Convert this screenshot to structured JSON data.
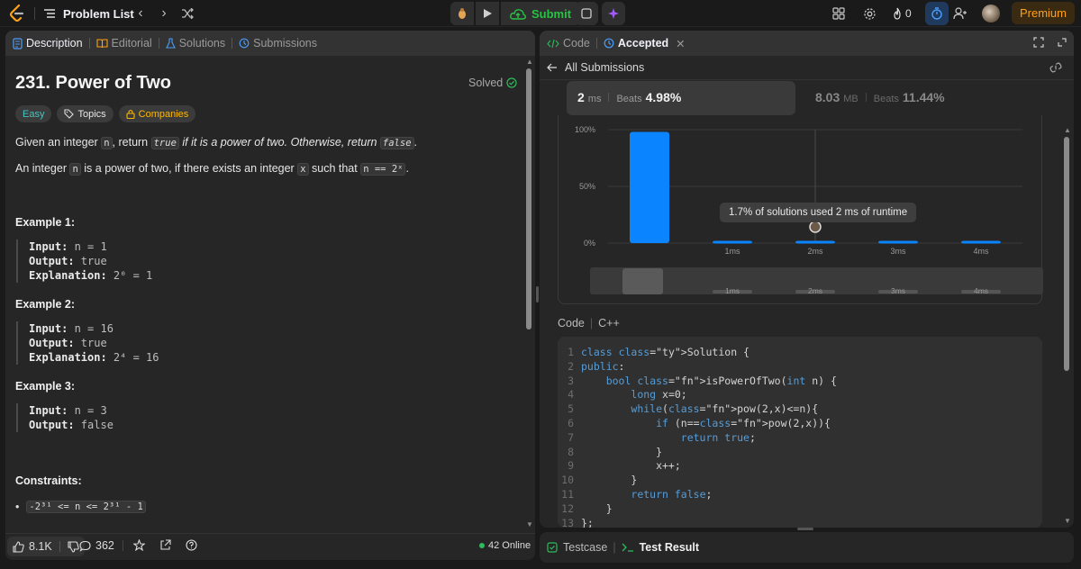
{
  "topbar": {
    "problem_list_label": "Problem List",
    "submit_label": "Submit",
    "fire_count": "0",
    "premium_label": "Premium"
  },
  "left_tabs": [
    {
      "label": "Description",
      "active": true,
      "icon": "description-icon"
    },
    {
      "label": "Editorial",
      "active": false,
      "icon": "book-icon"
    },
    {
      "label": "Solutions",
      "active": false,
      "icon": "flask-icon"
    },
    {
      "label": "Submissions",
      "active": false,
      "icon": "history-icon"
    }
  ],
  "problem": {
    "title": "231. Power of Two",
    "status": "Solved",
    "difficulty": "Easy",
    "topics_label": "Topics",
    "companies_label": "Companies",
    "para1_a": "Given an integer ",
    "para1_n": "n",
    "para1_b": ", return ",
    "para1_true": "true",
    "para1_c": " if it is a power of two. Otherwise, return ",
    "para1_false": "false",
    "para1_d": ".",
    "para2_a": "An integer ",
    "para2_n": "n",
    "para2_b": " is a power of two, if there exists an integer ",
    "para2_x": "x",
    "para2_c": " such that ",
    "para2_expr": "n == 2ˣ",
    "para2_d": ".",
    "examples": [
      {
        "title": "Example 1:",
        "input_label": "Input:",
        "input": " n = 1",
        "output_label": "Output:",
        "output": " true",
        "explanation_label": "Explanation:",
        "explanation": " 2⁰ = 1"
      },
      {
        "title": "Example 2:",
        "input_label": "Input:",
        "input": " n = 16",
        "output_label": "Output:",
        "output": " true",
        "explanation_label": "Explanation:",
        "explanation": " 2⁴ = 16"
      },
      {
        "title": "Example 3:",
        "input_label": "Input:",
        "input": " n = 3",
        "output_label": "Output:",
        "output": " false"
      }
    ],
    "constraints_title": "Constraints:",
    "constraint_1": "-2³¹ <= n <= 2³¹ - 1"
  },
  "left_footer": {
    "likes": "8.1K",
    "comments": "362",
    "online": "42 Online"
  },
  "right_tabs": [
    {
      "label": "Code",
      "active": false
    },
    {
      "label": "Accepted",
      "active": true
    }
  ],
  "submission": {
    "back_label": "All Submissions",
    "runtime_value": "2",
    "runtime_unit": "ms",
    "runtime_beats_label": "Beats",
    "runtime_beats": "4.98%",
    "memory_value": "8.03",
    "memory_unit": "MB",
    "memory_beats_label": "Beats",
    "memory_beats": "11.44%",
    "tooltip": "1.7% of solutions used 2 ms of runtime",
    "code_label": "Code",
    "language": "C++"
  },
  "chart_data": {
    "type": "bar",
    "categories": [
      "",
      "1ms",
      "2ms",
      "3ms",
      "4ms"
    ],
    "values": [
      98,
      2,
      2,
      2,
      2
    ],
    "ylim": [
      0,
      100
    ],
    "yticks": [
      "100%",
      "50%",
      "0%"
    ],
    "xlabel": "",
    "ylabel": "",
    "bar_color": "#0a84ff",
    "selected_category": "2ms",
    "range_labels": [
      "1ms",
      "2ms",
      "3ms",
      "4ms"
    ]
  },
  "code_lines": [
    "class Solution {",
    "public:",
    "    bool isPowerOfTwo(int n) {",
    "        long x=0;",
    "        while(pow(2,x)<=n){",
    "            if (n==pow(2,x)){",
    "                return true;",
    "            }",
    "            x++;",
    "        }",
    "        return false;",
    "    }",
    "};"
  ],
  "bottom_tabs": [
    {
      "label": "Testcase",
      "active": false
    },
    {
      "label": "Test Result",
      "active": true
    }
  ],
  "colors": {
    "accent_green": "#28c244",
    "accent_blue": "#0a84ff",
    "premium": "#ffa116",
    "easy": "#46c6c2"
  }
}
